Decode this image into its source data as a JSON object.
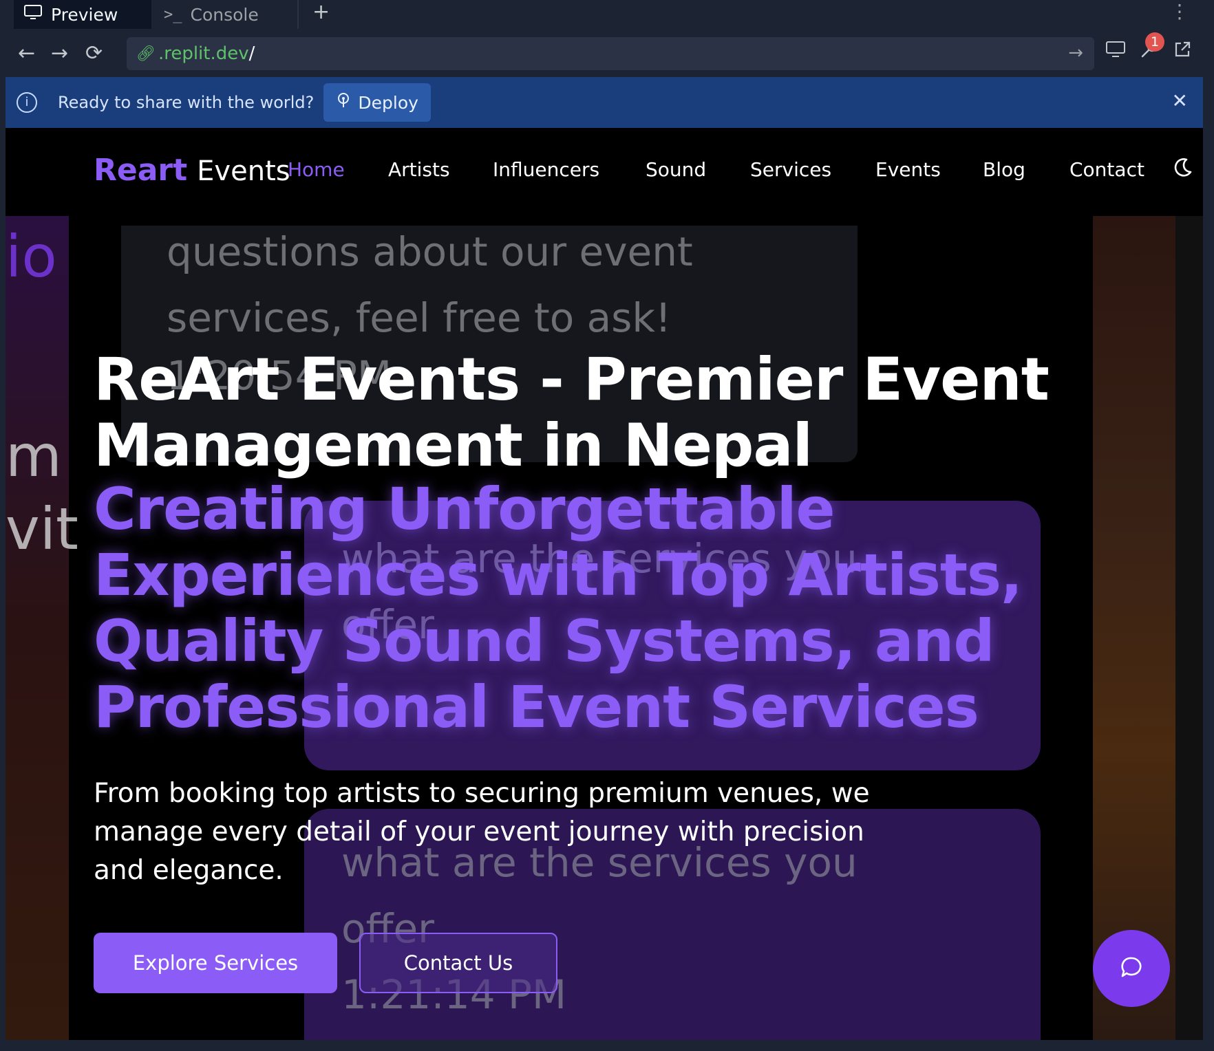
{
  "browser": {
    "tabs": [
      {
        "label": "Preview"
      },
      {
        "label": "Console"
      }
    ],
    "add_tab": "+",
    "url_host": ".replit.dev",
    "url_path": "/",
    "notification_count": "1"
  },
  "banner": {
    "message": "Ready to share with the world?",
    "deploy_label": "Deploy"
  },
  "site": {
    "logo_primary": "Reart",
    "logo_secondary": "Events",
    "nav": [
      "Home",
      "Artists",
      "Influencers",
      "Sound",
      "Services",
      "Events",
      "Blog",
      "Contact"
    ],
    "active_nav": "Home",
    "accent": "#8b5cf6",
    "hero_title": "ReArt Events - Premier Event Management in Nepal",
    "hero_subtitle": "Creating Unforgettable Experiences with Top Artists, Quality Sound Systems, and Professional Event Services",
    "hero_lead": "From booking top artists to securing premium venues, we manage every detail of your event journey with precision and elegance.",
    "cta_primary": "Explore Services",
    "cta_secondary": "Contact Us"
  },
  "background_ghost": {
    "card1_text": "questions about our event services, feel free to ask!",
    "card1_time": "1:20:54 PM",
    "card2_text": "what are the services you offer",
    "card3_text": "what are the services you offer",
    "card3_time": "1:21:14 PM",
    "left_fragments": [
      "io",
      "m",
      "vit"
    ]
  }
}
